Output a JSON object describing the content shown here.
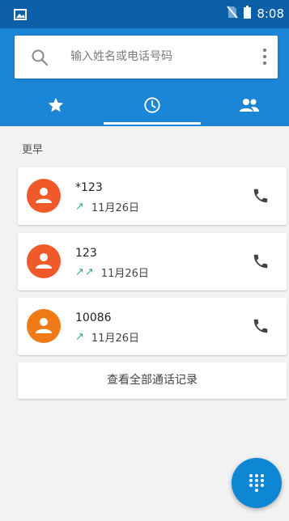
{
  "status_bar": {
    "time": "8:08"
  },
  "search": {
    "placeholder": "输入姓名或电话号码"
  },
  "tabs": [
    {
      "name": "favorites",
      "icon": "star-icon"
    },
    {
      "name": "recent",
      "icon": "clock-icon",
      "active": true
    },
    {
      "name": "contacts",
      "icon": "people-icon"
    }
  ],
  "section": {
    "title": "更早"
  },
  "calls": [
    {
      "name": "*123",
      "type_icon": "↗",
      "date": "11月26日",
      "avatar_color": "#f05a2a"
    },
    {
      "name": "123",
      "type_icon": "↗↗",
      "date": "11月26日",
      "avatar_color": "#f05a2a"
    },
    {
      "name": "10086",
      "type_icon": "↗",
      "date": "11月26日",
      "avatar_color": "#f07a16"
    }
  ],
  "view_all": {
    "label": "查看全部通话记录"
  },
  "colors": {
    "status_bar": "#0a5fa7",
    "header": "#1b86d6",
    "fab": "#0d86d3",
    "outgoing_arrow": "#2bb673"
  }
}
